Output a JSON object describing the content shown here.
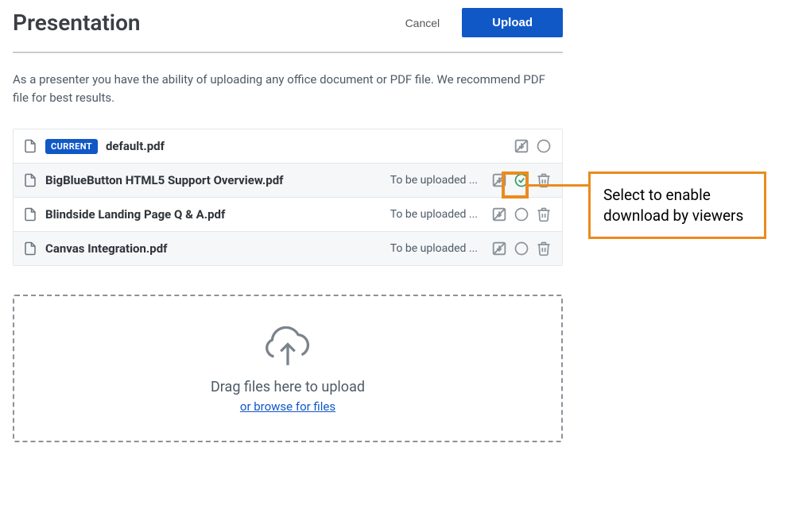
{
  "header": {
    "title": "Presentation",
    "cancel_label": "Cancel",
    "upload_label": "Upload"
  },
  "description": "As a presenter you have the ability of uploading any office document or PDF file. We recommend PDF file for best results.",
  "files": [
    {
      "name": "default.pdf",
      "badge": "CURRENT",
      "status": ""
    },
    {
      "name": "BigBlueButton HTML5 Support Overview.pdf",
      "badge": "",
      "status": "To be uploaded ..."
    },
    {
      "name": "Blindside Landing Page Q & A.pdf",
      "badge": "",
      "status": "To be uploaded ..."
    },
    {
      "name": "Canvas Integration.pdf",
      "badge": "",
      "status": "To be uploaded ..."
    }
  ],
  "dropzone": {
    "drag_label": "Drag files here to upload",
    "browse_label": "or browse for files"
  },
  "callout": {
    "text": "Select to enable download by viewers"
  }
}
